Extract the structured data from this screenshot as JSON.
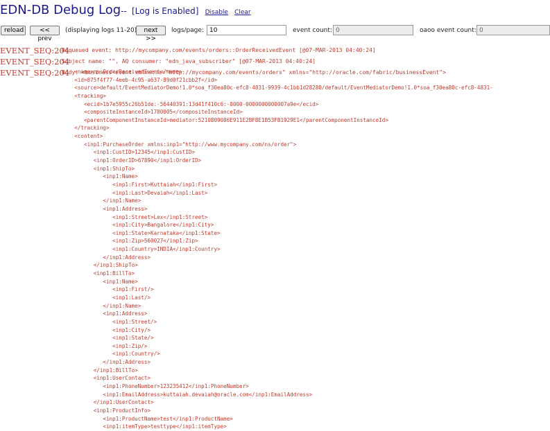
{
  "header": {
    "title": "EDN-DB Debug Log",
    "separator": "--",
    "status": "[Log is Enabled]",
    "disable_link": "Disable",
    "clear_link": "Clear"
  },
  "toolbar": {
    "reload_label": "reload",
    "prev_label": "<< prev",
    "displaying_text": "(displaying logs 11-20)",
    "next_label": "next >>",
    "logs_per_page_label": "logs/page:",
    "logs_per_page_value": "10",
    "event_count_label": "event count:",
    "event_count_value": "0",
    "oaoo_event_count_label": "oaoo event count:",
    "oaoo_event_count_value": "0"
  },
  "log": {
    "entries": [
      {
        "seq": "EVENT_SEQ:204",
        "message": "Dequeued event: http://mycompany.com/events/orders::OrderReceivedEvent [@07-MAR-2013 04:40:24]"
      },
      {
        "seq": "EVENT_SEQ:204",
        "message": "Subject name: \"\", AQ consumer: \"edn_java_subscriber\" [@07-MAR-2013 04:40:24]"
      },
      {
        "seq": "EVENT_SEQ:204",
        "message": "Body: <business-event xmlns:ns=\"http://mycompany.com/events/orders\" xmlns=\"http://oracle.com/fabric/businessEvent\">"
      }
    ],
    "body_lines": [
      "    <name>ns:OrderReceivedEvent</name>",
      "    <id>875f4f77-4eeb-4c95-a637-89d0f21cbb2f</id>",
      "    <source>default/EventMediatorDemo!1.0*soa_f30ea80c-efc8-4831-9939-4c1bb1d28280/default/EventMediatorDemo!1.0*soa_f30ea80c-efc8-4831-",
      "    <tracking>",
      "       <ecid>1b7e5955c26b51de:-56440391:13d41f410c6:-8000-0000000000007a9e</ecid>",
      "       <compositeInstanceId>1780005</compositeInstanceId>",
      "       <parentComponentInstanceId>mediator:5210B09086E911E2BFBE1B53FB1929E1</parentComponentInstanceId>",
      "    </tracking>",
      "    <content>",
      "       <inp1:PurchaseOrder xmlns:inp1=\"http://www.mycompany.com/ns/order\">",
      "          <inp1:CustID>12345</inp1:CustID>",
      "          <inp1:OrderID>67890</inp1:OrderID>",
      "          <inp1:ShipTo>",
      "             <inp1:Name>",
      "                <inp1:First>Kuttaiah</inp1:First>",
      "                <inp1:Last>Devaiah</inp1:Last>",
      "             </inp1:Name>",
      "             <inp1:Address>",
      "                <inp1:Street>Lex</inp1:Street>",
      "                <inp1:City>Bangalore</inp1:City>",
      "                <inp1:State>Karnataka</inp1:State>",
      "                <inp1:Zip>560027</inp1:Zip>",
      "                <inp1:Country>INDIA</inp1:Country>",
      "             </inp1:Address>",
      "          </inp1:ShipTo>",
      "          <inp1:BillTo>",
      "             <inp1:Name>",
      "                <inp1:First/>",
      "                <inp1:Last/>",
      "             </inp1:Name>",
      "             <inp1:Address>",
      "                <inp1:Street/>",
      "                <inp1:City/>",
      "                <inp1:State/>",
      "                <inp1:Zip/>",
      "                <inp1:Country/>",
      "             </inp1:Address>",
      "          </inp1:BillTo>",
      "          <inp1:UserContact>",
      "             <inp1:PhoneNumber>123235412</inp1:PhoneNumber>",
      "             <inp1:EmailAddress>kuttaiah.devaiah@oracle.com</inp1:EmailAddress>",
      "          </inp1:UserContact>",
      "          <inp1:ProductInfo>",
      "             <inp1:ProductName>test</inp1:ProductName>",
      "             <inp1:itemType>testtype</inp1:itemType>"
    ]
  }
}
